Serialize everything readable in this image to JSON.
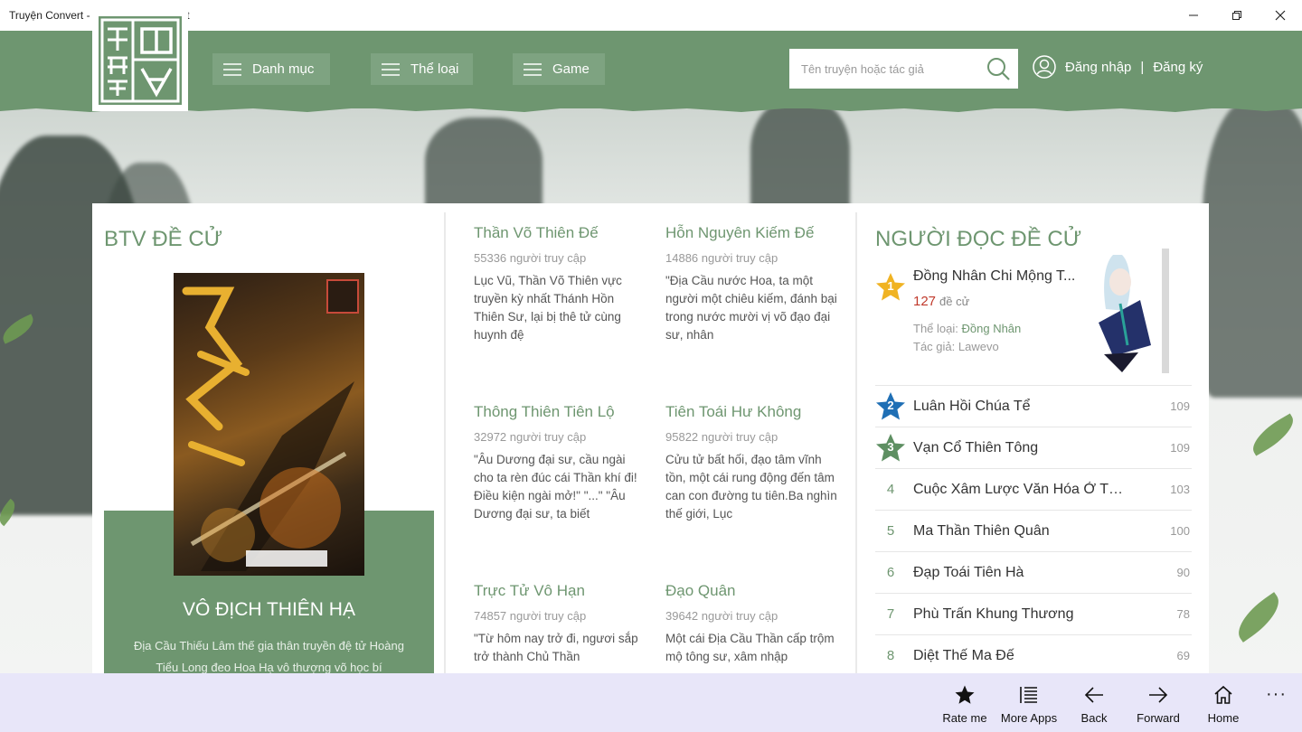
{
  "window": {
    "title": "Truyện Convert - Doc Truyen Convert"
  },
  "header": {
    "nav": [
      {
        "label": "Danh mục"
      },
      {
        "label": "Thể loại"
      },
      {
        "label": "Game"
      }
    ],
    "search_placeholder": "Tên truyện hoặc tác giả",
    "login_label": "Đăng nhập",
    "separator": "|",
    "register_label": "Đăng ký"
  },
  "btv": {
    "section_title": "BTV ĐỀ CỬ",
    "featured_title": "VÔ ĐỊCH THIÊN HẠ",
    "featured_desc": "Địa Cầu Thiếu Lâm thế gia thân truyền đệ tử Hoàng Tiểu Long đeo Hoa Hạ vô thượng võ học bí"
  },
  "books": [
    {
      "title": "Thần Võ Thiên Đế",
      "views": "55336 người truy cập",
      "desc": "Lục Vũ, Thần Võ Thiên vực truyền kỳ nhất Thánh Hồn Thiên Sư, lại bị thê tử cùng huynh đệ"
    },
    {
      "title": "Hỗn Nguyên Kiếm Đế",
      "views": "14886 người truy cập",
      "desc": "\"Địa Cầu nước Hoa, ta một người một chiêu kiếm, đánh bại trong nước mười vị võ đạo đại sư, nhân"
    },
    {
      "title": "Thông Thiên Tiên Lộ",
      "views": "32972 người truy cập",
      "desc": "\"Âu Dương đại sư, cầu ngài cho ta rèn đúc cái Thần khí đi! Điều kiện ngài mở!\" \"...\" \"Âu Dương đại sư, ta biết"
    },
    {
      "title": "Tiên Toái Hư Không",
      "views": "95822 người truy cập",
      "desc": "Cửu tử bất hối, đạo tâm vĩnh tồn, một cái rung động đến tâm can con đường tu tiên.Ba nghìn thế giới, Lục"
    },
    {
      "title": "Trực Tử Vô Hạn",
      "views": "74857 người truy cập",
      "desc": "\"Từ hôm nay trở đi, ngươi sắp trở thành Chủ Thần"
    },
    {
      "title": "Đạo Quân",
      "views": "39642 người truy cập",
      "desc": "Một cái Địa Cầu Thần cấp trộm mộ tông sư, xâm nhập"
    }
  ],
  "reader": {
    "section_title": "NGƯỜI ĐỌC ĐỀ CỬ",
    "top": {
      "rank": "1",
      "title": "Đồng Nhân Chi Mộng T...",
      "votes": "127",
      "votes_label": "đề cử",
      "genre_label": "Thể loại:",
      "genre": "Đồng Nhân",
      "author_label": "Tác giả:",
      "author": "Lawevo"
    },
    "list": [
      {
        "rank": "2",
        "title": "Luân Hồi Chúa Tể",
        "count": "109",
        "star_color": "#1f6fb5"
      },
      {
        "rank": "3",
        "title": "Vạn Cổ Thiên Tông",
        "count": "109",
        "star_color": "#5e8f62"
      },
      {
        "rank": "4",
        "title": "Cuộc Xâm Lược Văn Hóa Ở Thế...",
        "count": "103"
      },
      {
        "rank": "5",
        "title": "Ma Thần Thiên Quân",
        "count": "100"
      },
      {
        "rank": "6",
        "title": "Đạp Toái Tiên Hà",
        "count": "90"
      },
      {
        "rank": "7",
        "title": "Phù Trấn Khung Thương",
        "count": "78"
      },
      {
        "rank": "8",
        "title": "Diệt Thế Ma Đế",
        "count": "69"
      }
    ]
  },
  "appbar": {
    "rate": "Rate me",
    "more_apps": "More Apps",
    "back": "Back",
    "forward": "Forward",
    "home": "Home",
    "more": "···"
  },
  "colors": {
    "accent": "#6e9670",
    "gold_star": "#f0b323",
    "blue_star": "#1f6fb5",
    "green_star": "#5e8f62"
  }
}
